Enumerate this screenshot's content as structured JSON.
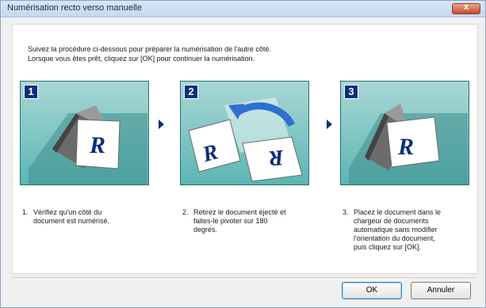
{
  "window": {
    "title": "Numérisation recto verso manuelle",
    "close_label": "x"
  },
  "instructions": {
    "line1": "Suivez la procédure ci-dessous pour préparer la numérisation de l'autre côté.",
    "line2": "Lorsque vous êtes prêt, cliquez sur [OK] pour continuer la numérisation."
  },
  "steps": [
    {
      "number": "1",
      "desc_number": "1.",
      "lines": [
        "Vérifiez qu'un côté du",
        "document est numérisé."
      ]
    },
    {
      "number": "2",
      "desc_number": "2.",
      "lines": [
        "Retirez le document éjecté et",
        "faites-le pivoter sur 180",
        "degrés."
      ]
    },
    {
      "number": "3",
      "desc_number": "3.",
      "lines": [
        "Placez le document dans le",
        "chargeur de documents",
        "automatique sans modifier",
        "l'orientation du document,",
        "puis cliquez sur [OK]."
      ]
    }
  ],
  "buttons": {
    "ok": "OK",
    "cancel": "Annuler"
  },
  "colors": {
    "panel_teal": "#5bb6b3",
    "step_badge": "#0b2e7a",
    "rotate_arrow": "#2f6fd1"
  }
}
